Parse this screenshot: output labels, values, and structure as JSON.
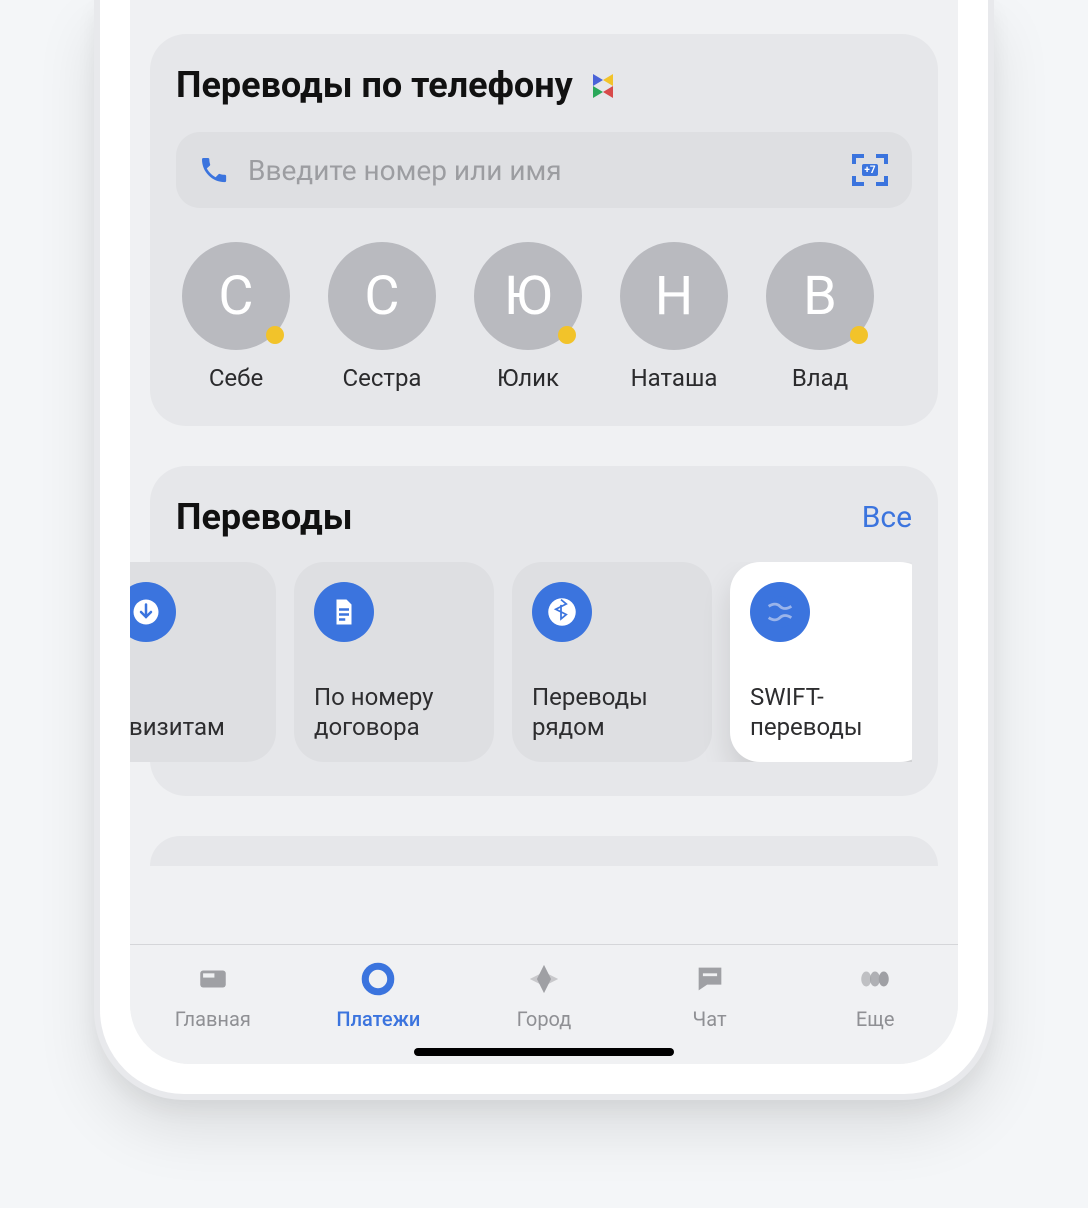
{
  "phone_section": {
    "title": "Переводы по телефону",
    "input_placeholder": "Введите номер или имя",
    "scan_badge": "+7"
  },
  "contacts": [
    {
      "initial": "С",
      "name": "Себе",
      "dot": true
    },
    {
      "initial": "С",
      "name": "Сестра",
      "dot": false
    },
    {
      "initial": "Ю",
      "name": "Юлик",
      "dot": true
    },
    {
      "initial": "Н",
      "name": "Наташа",
      "dot": false
    },
    {
      "initial": "В",
      "name": "Влад",
      "dot": true
    }
  ],
  "transfers_section": {
    "title": "Переводы",
    "all_label": "Все",
    "tiles": [
      {
        "label": "квизитам",
        "icon": "recv",
        "selected": false
      },
      {
        "label": "По номеру договора",
        "icon": "doc",
        "selected": false
      },
      {
        "label": "Переводы рядом",
        "icon": "bt",
        "selected": false
      },
      {
        "label": "SWIFT-переводы",
        "icon": "globe",
        "selected": true
      }
    ]
  },
  "tabs": [
    {
      "label": "Главная",
      "icon": "home",
      "active": false
    },
    {
      "label": "Платежи",
      "icon": "circle",
      "active": true
    },
    {
      "label": "Город",
      "icon": "diamond",
      "active": false
    },
    {
      "label": "Чат",
      "icon": "chat",
      "active": false
    },
    {
      "label": "Еще",
      "icon": "more",
      "active": false
    }
  ]
}
